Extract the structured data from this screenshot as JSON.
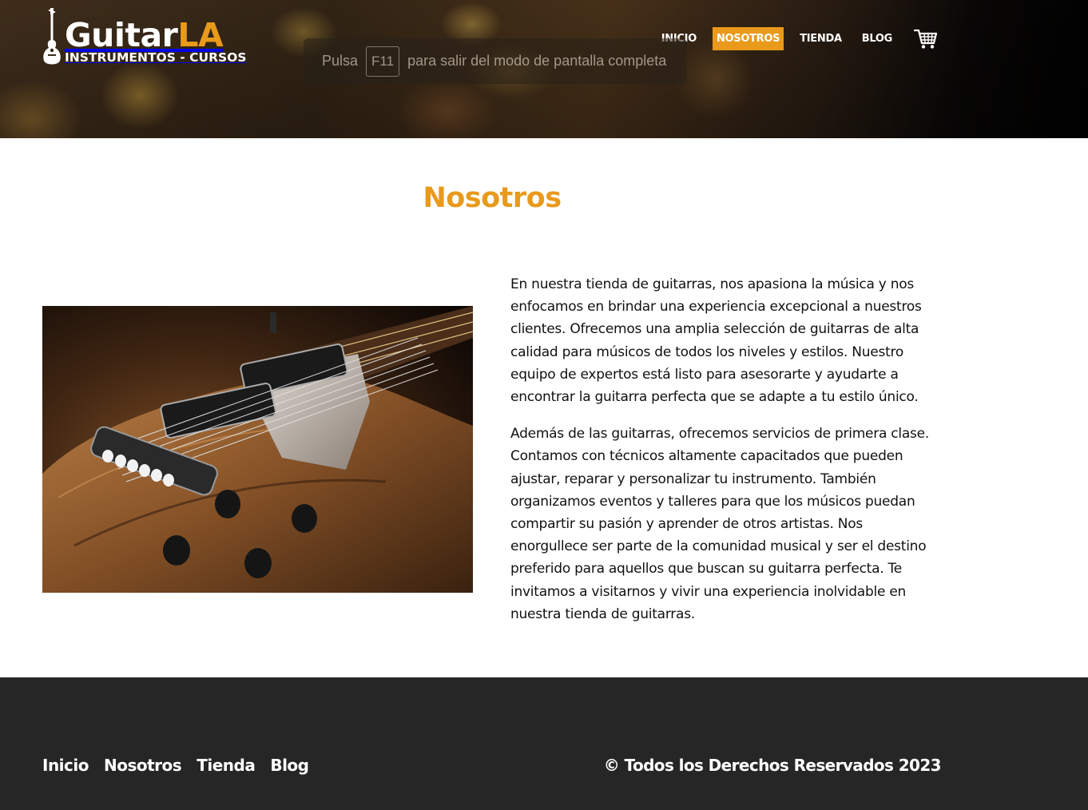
{
  "header": {
    "logo": {
      "main": "Guitar",
      "accent": "LA",
      "subtitle": "INSTRUMENTOS - CURSOS"
    },
    "nav": [
      {
        "label": "INICIO",
        "active": false
      },
      {
        "label": "NOSOTROS",
        "active": true
      },
      {
        "label": "TIENDA",
        "active": false
      },
      {
        "label": "BLOG",
        "active": false
      }
    ],
    "cart_icon": "cart-icon"
  },
  "fullscreen_hint": {
    "before": "Pulsa",
    "key": "F11",
    "after": "para salir del modo de pantalla completa"
  },
  "main": {
    "title": "Nosotros",
    "image_icon": "guitar-photo",
    "paragraphs": [
      "En nuestra tienda de guitarras, nos apasiona la música y nos enfocamos en brindar una experiencia excepcional a nuestros clientes. Ofrecemos una amplia selección de guitarras de alta calidad para músicos de todos los niveles y estilos. Nuestro equipo de expertos está listo para asesorarte y ayudarte a encontrar la guitarra perfecta que se adapte a tu estilo único.",
      "Además de las guitarras, ofrecemos servicios de primera clase. Contamos con técnicos altamente capacitados que pueden ajustar, reparar y personalizar tu instrumento. También organizamos eventos y talleres para que los músicos puedan compartir su pasión y aprender de otros artistas. Nos enorgullece ser parte de la comunidad musical y ser el destino preferido para aquellos que buscan su guitarra perfecta. Te invitamos a visitarnos y vivir una experiencia inolvidable en nuestra tienda de guitarras."
    ]
  },
  "footer": {
    "nav": [
      "Inicio",
      "Nosotros",
      "Tienda",
      "Blog"
    ],
    "copyright": "© Todos los Derechos Reservados 2023"
  },
  "colors": {
    "accent": "#e99a1b",
    "footer_bg": "#262626"
  }
}
